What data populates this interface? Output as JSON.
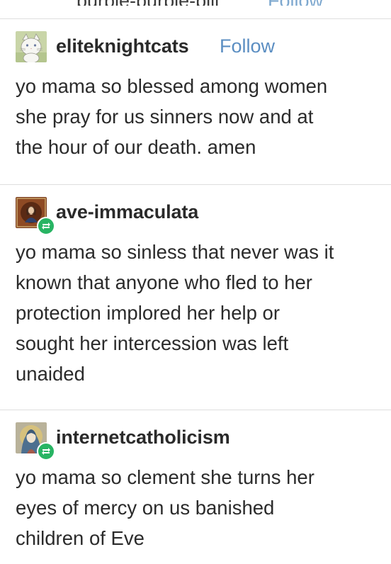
{
  "top_fragment": {
    "username": "purple-purple-pill",
    "follow_label": "Follow"
  },
  "posts": [
    {
      "username": "eliteknightcats",
      "follow_label": "Follow",
      "avatar_icon": "cat-avatar-icon",
      "reblog": false,
      "body_lines": [
        "yo mama so blessed among women",
        "she pray for us sinners now and at",
        "the hour of our death. amen"
      ]
    },
    {
      "username": "ave-immaculata",
      "avatar_icon": "madonna-painting-avatar-icon",
      "reblog": true,
      "body_lines": [
        "yo mama so sinless that never was it",
        "known that anyone who fled to her",
        "protection implored her help or",
        "sought her intercession was left",
        "unaided"
      ]
    },
    {
      "username": "internetcatholicism",
      "avatar_icon": "mary-icon-avatar-icon",
      "reblog": true,
      "body_lines": [
        "yo mama so clement she turns her",
        "eyes of mercy on us banished",
        "children of Eve"
      ]
    }
  ],
  "colors": {
    "follow_link": "#5b8ec2",
    "reblog_badge": "#28b463",
    "divider": "#dedede",
    "text": "#2b2b2b"
  }
}
